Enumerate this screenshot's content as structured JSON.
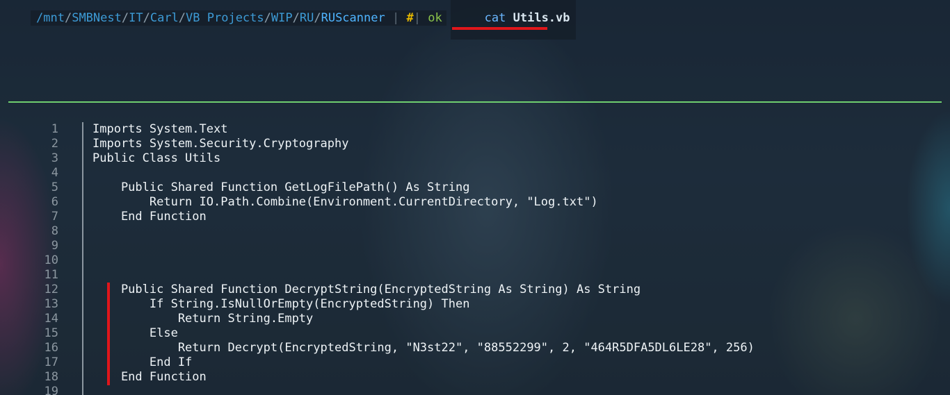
{
  "prompt": {
    "path_segments": [
      "/mnt",
      "SMBNest",
      "IT",
      "Carl",
      "VB Projects",
      "WIP",
      "RU",
      "RUScanner"
    ],
    "separator": "/",
    "pipe": "|",
    "hash": "#",
    "status": "ok",
    "command": "cat",
    "argument": "Utils.vb"
  },
  "code_lines": [
    {
      "n": "1",
      "text": "Imports System.Text"
    },
    {
      "n": "2",
      "text": "Imports System.Security.Cryptography"
    },
    {
      "n": "3",
      "text": "Public Class Utils"
    },
    {
      "n": "4",
      "text": ""
    },
    {
      "n": "5",
      "text": "    Public Shared Function GetLogFilePath() As String"
    },
    {
      "n": "6",
      "text": "        Return IO.Path.Combine(Environment.CurrentDirectory, \"Log.txt\")"
    },
    {
      "n": "7",
      "text": "    End Function"
    },
    {
      "n": "8",
      "text": ""
    },
    {
      "n": "9",
      "text": ""
    },
    {
      "n": "10",
      "text": ""
    },
    {
      "n": "11",
      "text": ""
    },
    {
      "n": "12",
      "text": "    Public Shared Function DecryptString(EncryptedString As String) As String"
    },
    {
      "n": "13",
      "text": "        If String.IsNullOrEmpty(EncryptedString) Then"
    },
    {
      "n": "14",
      "text": "            Return String.Empty"
    },
    {
      "n": "15",
      "text": "        Else"
    },
    {
      "n": "16",
      "text": "            Return Decrypt(EncryptedString, \"N3st22\", \"88552299\", 2, \"464R5DFA5DL6LE28\", 256)"
    },
    {
      "n": "17",
      "text": "        End If"
    },
    {
      "n": "18",
      "text": "    End Function"
    },
    {
      "n": "19",
      "text": ""
    }
  ],
  "colors": {
    "path": "#3d9bd6",
    "command": "#6ab7ff",
    "ok": "#8bc34a",
    "hash": "#e6b800",
    "highlight": "#e0161b",
    "separator_line": "#6fcf6f",
    "code_text": "#eef3f6",
    "line_number": "#8c97a0"
  }
}
